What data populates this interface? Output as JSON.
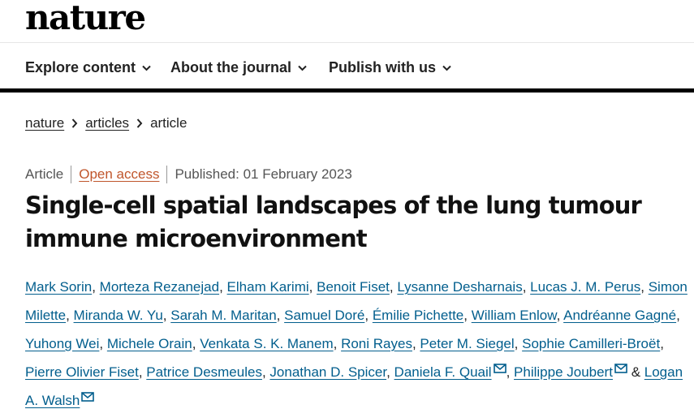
{
  "logo": "nature",
  "nav": [
    {
      "label": "Explore content"
    },
    {
      "label": "About the journal"
    },
    {
      "label": "Publish with us"
    }
  ],
  "breadcrumb": {
    "items": [
      "nature",
      "articles"
    ],
    "current": "article"
  },
  "meta": {
    "type": "Article",
    "access": "Open access",
    "published": "Published: 01 February 2023"
  },
  "title": "Single-cell spatial landscapes of the lung tumour immune microenvironment",
  "authors": [
    "Mark Sorin",
    "Morteza Rezanejad",
    "Elham Karimi",
    "Benoit Fiset",
    "Lysanne Desharnais",
    "Lucas J. M. Perus",
    "Simon Milette",
    "Miranda W. Yu",
    "Sarah M. Maritan",
    "Samuel Doré",
    "Émilie Pichette",
    "William Enlow",
    "Andréanne Gagné",
    "Yuhong Wei",
    "Michele Orain",
    "Venkata S. K. Manem",
    "Roni Rayes",
    "Peter M. Siegel",
    "Sophie Camilleri-Broët",
    "Pierre Olivier Fiset",
    "Patrice Desmeules",
    "Jonathan D. Spicer",
    "Daniela F. Quail",
    "Philippe Joubert",
    "Logan A. Walsh"
  ],
  "author_separator": ",",
  "author_conjunction": "&",
  "corresponding_authors": [
    "Daniela F. Quail",
    "Philippe Joubert",
    "Logan A. Walsh"
  ],
  "colors": {
    "link": "#025e8d",
    "open_access": "#c0562c",
    "nav_border": "#000000"
  }
}
